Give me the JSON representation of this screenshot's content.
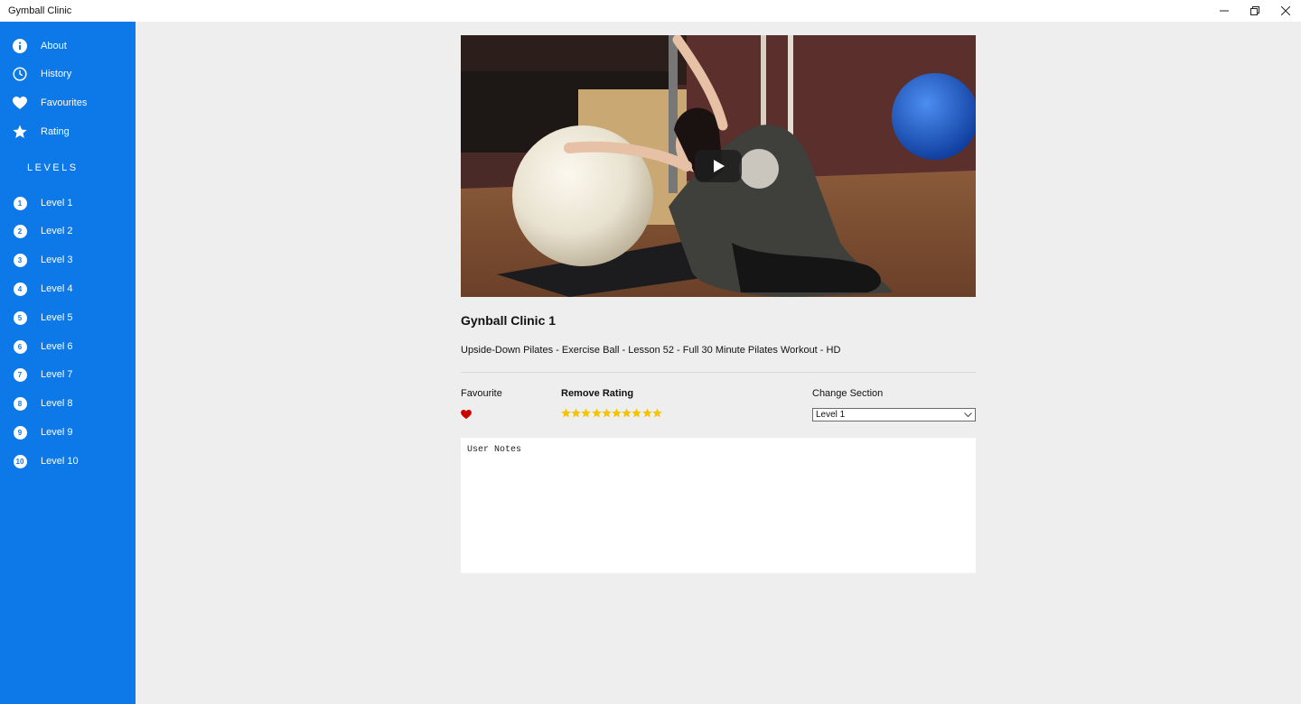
{
  "window": {
    "title": "Gymball Clinic",
    "controls": {
      "minimize": "minimize-icon",
      "restore": "restore-icon",
      "close": "close-icon"
    }
  },
  "sidebar": {
    "background": "#0d78e8",
    "items": [
      {
        "label": "About",
        "icon": "info-icon"
      },
      {
        "label": "History",
        "icon": "clock-icon"
      },
      {
        "label": "Favourites",
        "icon": "heart-icon"
      },
      {
        "label": "Rating",
        "icon": "star-icon"
      }
    ],
    "levels_heading": "LEVELS",
    "levels": [
      {
        "number": "1",
        "label": "Level 1"
      },
      {
        "number": "2",
        "label": "Level 2"
      },
      {
        "number": "3",
        "label": "Level 3"
      },
      {
        "number": "4",
        "label": "Level 4"
      },
      {
        "number": "5",
        "label": "Level 5"
      },
      {
        "number": "6",
        "label": "Level 6"
      },
      {
        "number": "7",
        "label": "Level 7"
      },
      {
        "number": "8",
        "label": "Level 8"
      },
      {
        "number": "9",
        "label": "Level 9"
      },
      {
        "number": "10",
        "label": "Level 10"
      }
    ]
  },
  "lesson": {
    "title": "Gynball Clinic 1",
    "description": "Upside-Down Pilates - Exercise Ball - Lesson 52 - Full 30 Minute Pilates Workout - HD",
    "video": {
      "play_icon": "play-icon"
    }
  },
  "favourite": {
    "label": "Favourite",
    "icon": "heart-icon",
    "active": true,
    "color": "#cc0000"
  },
  "rating": {
    "label": "Remove Rating",
    "stars": 10,
    "max": 10,
    "color": "#f5c400"
  },
  "section": {
    "label": "Change Section",
    "selected": "Level 1"
  },
  "notes": {
    "placeholder": "User Notes"
  }
}
